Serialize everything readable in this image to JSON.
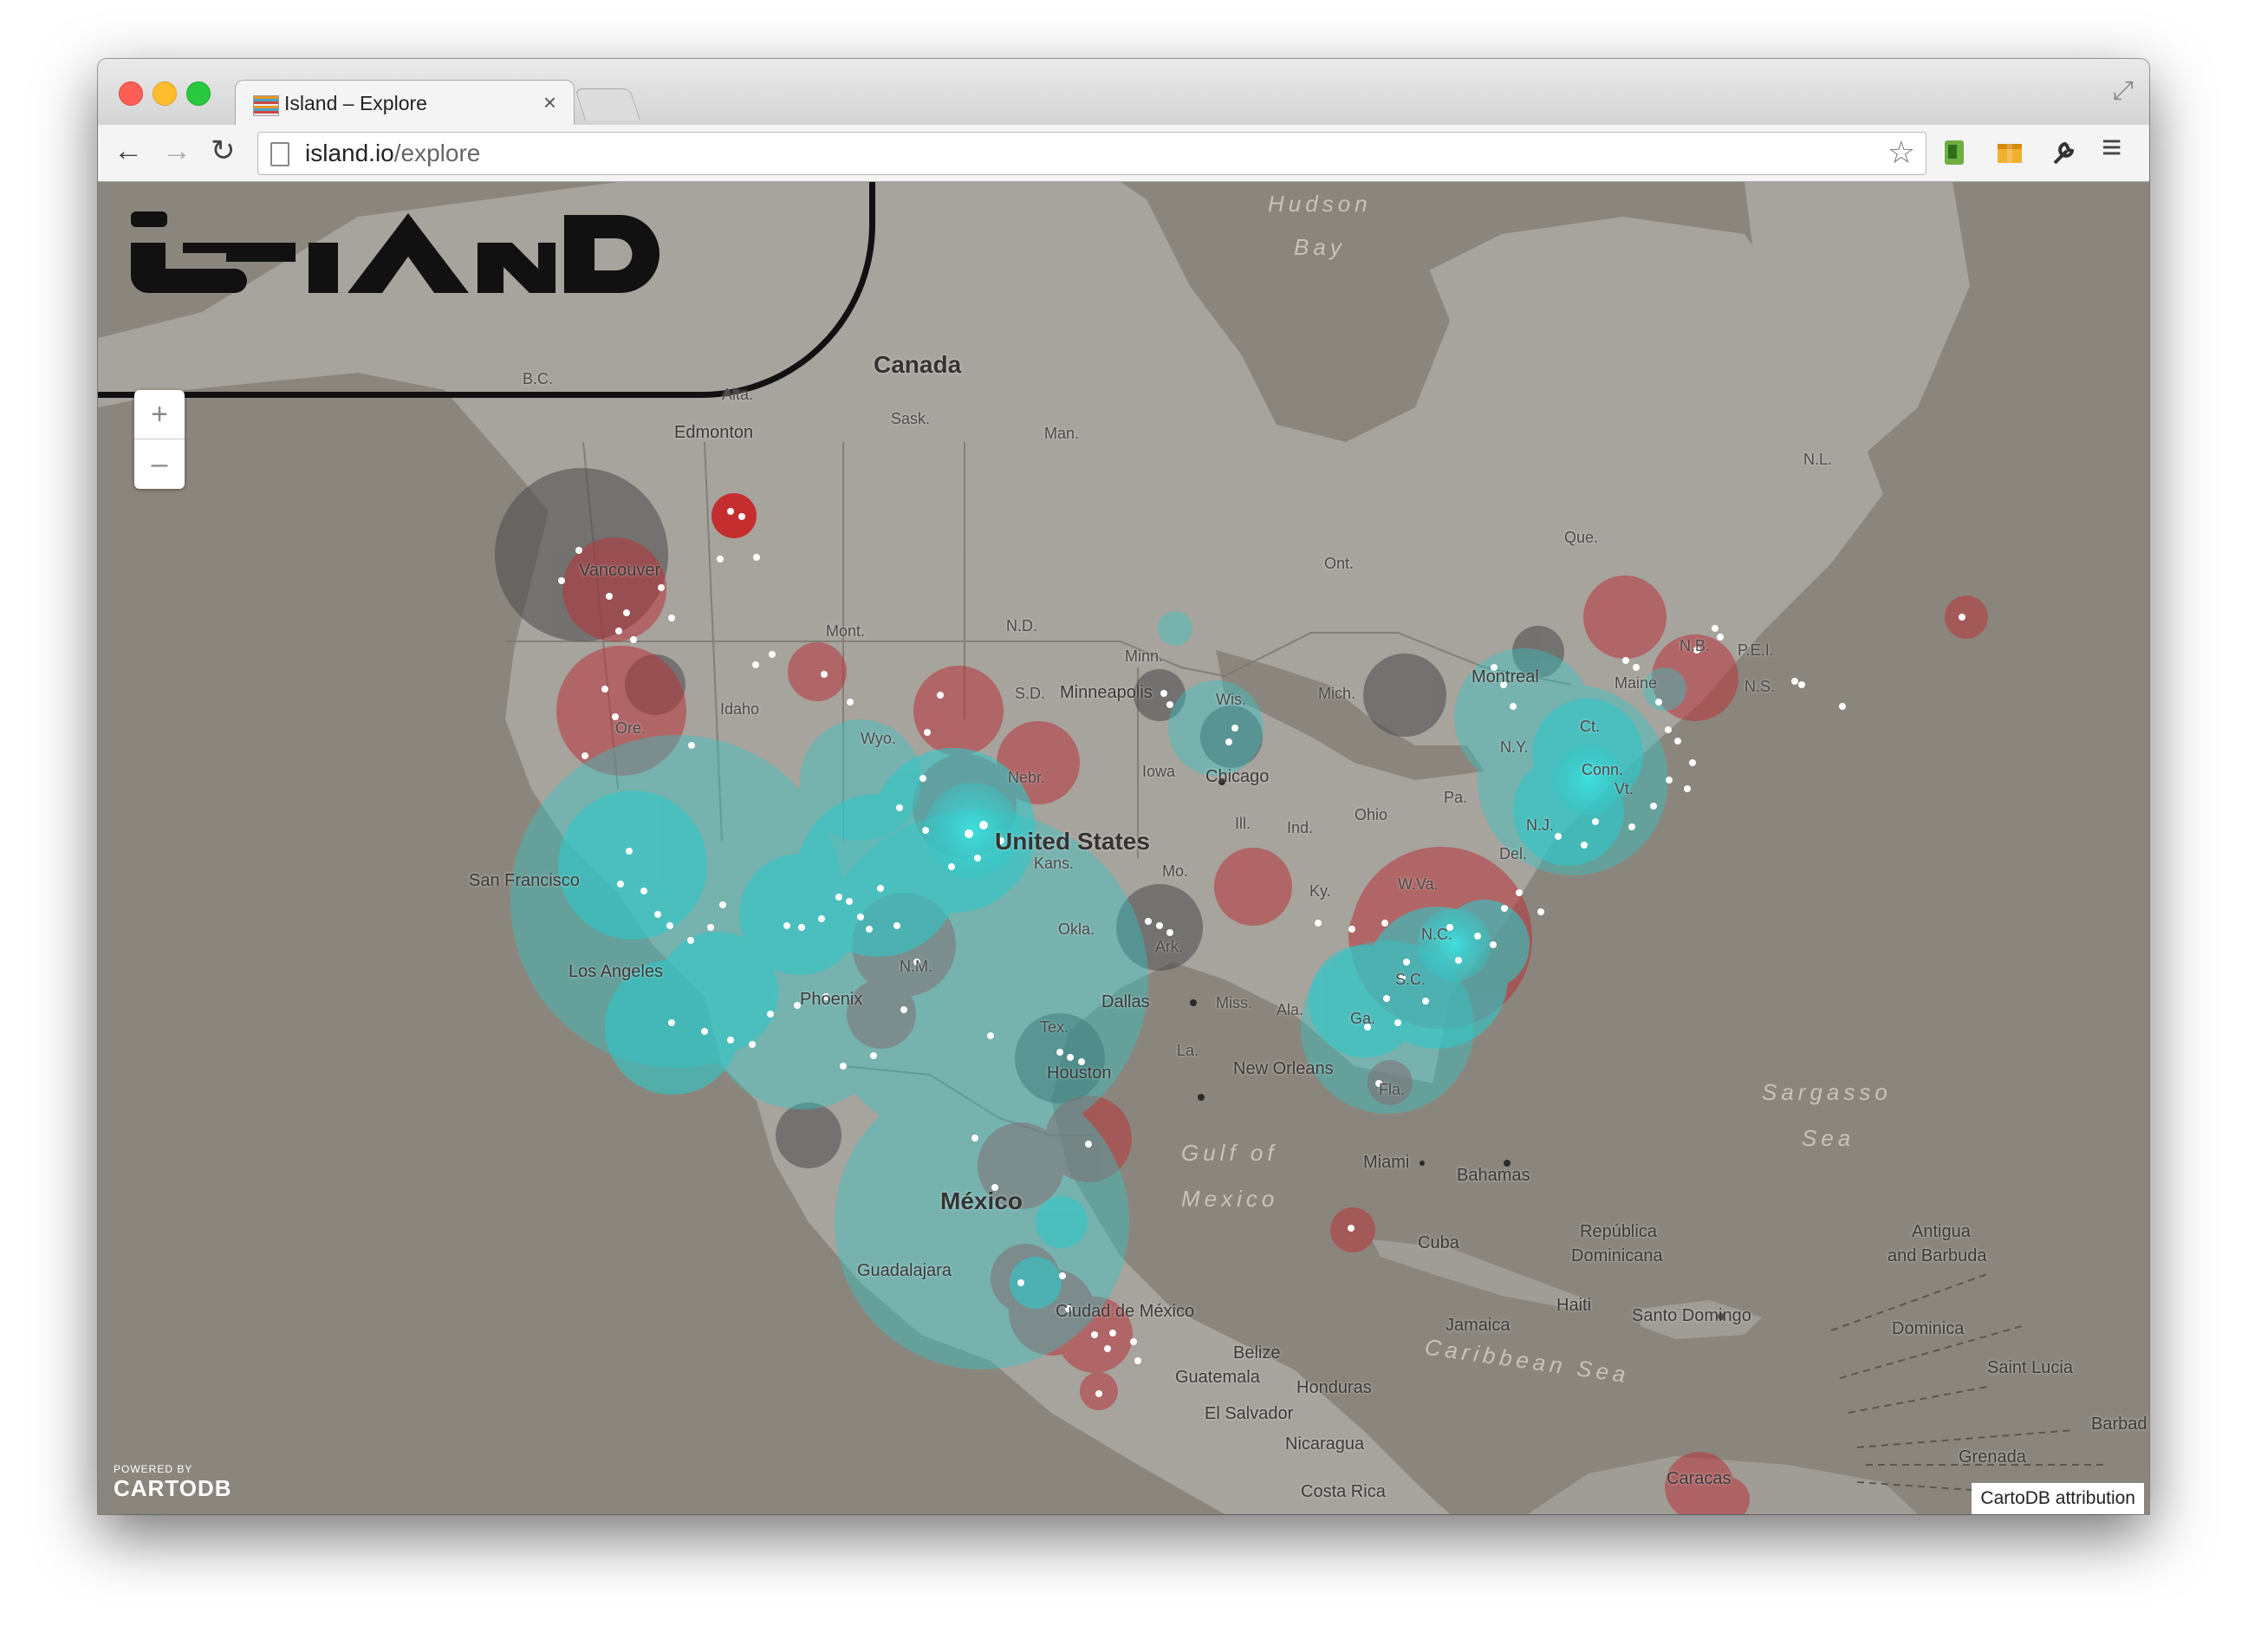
{
  "tab": {
    "title": "Island – Explore",
    "close": "×"
  },
  "toolbar": {
    "back": "←",
    "forward": "→",
    "reload": "↻",
    "url_host": "island.io",
    "url_path": "/explore",
    "star": "☆",
    "menu": "≡"
  },
  "map": {
    "zoom_in": "+",
    "zoom_out": "–",
    "powered_by": "POWERED BY",
    "brand": "CARTODB",
    "attribution": "CartoDB attribution",
    "labels": {
      "hudson1": "Hudson",
      "hudson2": "Bay",
      "canada": "Canada",
      "united_states": "United States",
      "mexico": "México",
      "gulf1": "Gulf of",
      "gulf2": "Mexico",
      "sargasso1": "Sargasso",
      "sargasso2": "Sea",
      "caribbean": "Caribbean Sea",
      "bc": "B.C.",
      "alta": "Alta.",
      "sask": "Sask.",
      "man": "Man.",
      "ont": "Ont.",
      "que": "Que.",
      "nl": "N.L.",
      "nb": "N.B.",
      "pei": "P.E.I.",
      "ns": "N.S.",
      "maine": "Maine",
      "edmonton": "Edmonton",
      "vancouver": "Vancouver",
      "mont": "Mont.",
      "nd": "N.D.",
      "sd": "S.D.",
      "minn": "Minn.",
      "minneapolis": "Minneapolis",
      "wis": "Wis.",
      "mich": "Mich.",
      "montreal": "Montreal",
      "ny": "N.Y.",
      "chicago": "Chicago",
      "iowa": "Iowa",
      "nebr": "Nebr.",
      "wyo": "Wyo.",
      "idaho": "Idaho",
      "ore": "Ore.",
      "san_francisco": "San Francisco",
      "los_angeles": "Los Angeles",
      "phoenix": "Phoenix",
      "nm": "N.M.",
      "kans": "Kans.",
      "mo": "Mo.",
      "ill": "Ill.",
      "ind": "Ind.",
      "ohio": "Ohio",
      "pa": "Pa.",
      "del": "Del.",
      "nj": "N.J.",
      "ky": "Ky.",
      "wva": "W.Va.",
      "nc": "N.C.",
      "sc": "S.C.",
      "ga": "Ga.",
      "ala": "Ala.",
      "miss": "Miss.",
      "la": "La.",
      "okla": "Okla.",
      "ark": "Ark.",
      "dallas": "Dallas",
      "tex": "Tex.",
      "houston": "Houston",
      "new_orleans": "New Orleans",
      "fla": "Fla.",
      "miami": "Miami",
      "bahamas": "Bahamas",
      "cuba": "Cuba",
      "republica1": "República",
      "republica2": "Dominicana",
      "haiti": "Haiti",
      "santo_domingo": "Santo Domingo",
      "jamaica": "Jamaica",
      "antigua1": "Antigua",
      "antigua2": "and Barbuda",
      "dominica": "Dominica",
      "saint_lucia": "Saint Lucia",
      "barbados": "Barbad",
      "grenada": "Grenada",
      "guadalajara": "Guadalajara",
      "ciudad": "Ciudad de México",
      "belize": "Belize",
      "guatemala": "Guatemala",
      "honduras": "Honduras",
      "el_salvador": "El Salvador",
      "nicaragua": "Nicaragua",
      "costa_rica": "Costa Rica",
      "caracas": "Caracas",
      "conn": "Conn.",
      "ct": "Ct.",
      "vt": "Vt."
    }
  },
  "colors": {
    "cyan": "#2fc9c9",
    "red": "#b8343a",
    "dark": "#4a4a4a",
    "water": "#8b867d"
  }
}
